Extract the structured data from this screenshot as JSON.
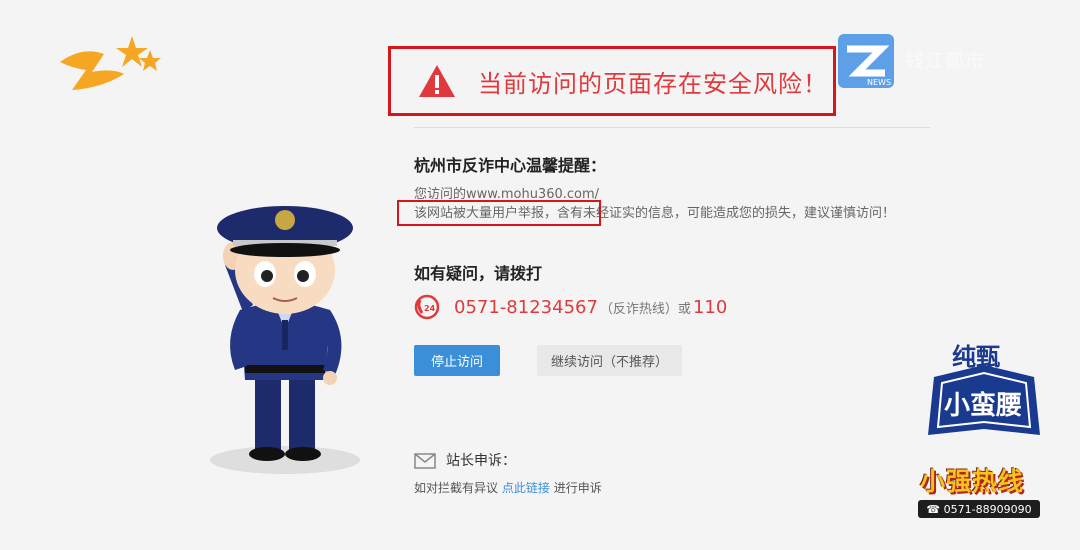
{
  "warning": {
    "title": "当前访问的页面存在安全风险！"
  },
  "reminder": {
    "heading": "杭州市反诈中心温馨提醒：",
    "visited": "您访问的www.mohu360.com/",
    "detail": "该网站被大量用户举报，含有未经证实的信息，可能造成您的损失，建议谨慎访问！"
  },
  "contact": {
    "heading": "如有疑问，请拨打",
    "phone": "0571-81234567",
    "phone_note": "（反诈热线）或",
    "alt_phone": "110",
    "icon": "24h-phone-icon"
  },
  "buttons": {
    "stop": "停止访问",
    "continue": "继续访问（不推荐）"
  },
  "appeal": {
    "label": "站长申诉：",
    "prefix": "如对拦截有异议",
    "link": "点此链接",
    "suffix": "进行申诉"
  },
  "overlay": {
    "news_logo": "NEWS",
    "faded_text": "钱江都市",
    "badge_top": "纯甄",
    "badge_main": "小蛮腰",
    "hotline_name": "小强热线",
    "hotline_phone": "0571-88909090"
  },
  "colors": {
    "warning_red": "#e0393e",
    "frame_red": "#d3171b",
    "button_blue": "#3b8fd8"
  }
}
